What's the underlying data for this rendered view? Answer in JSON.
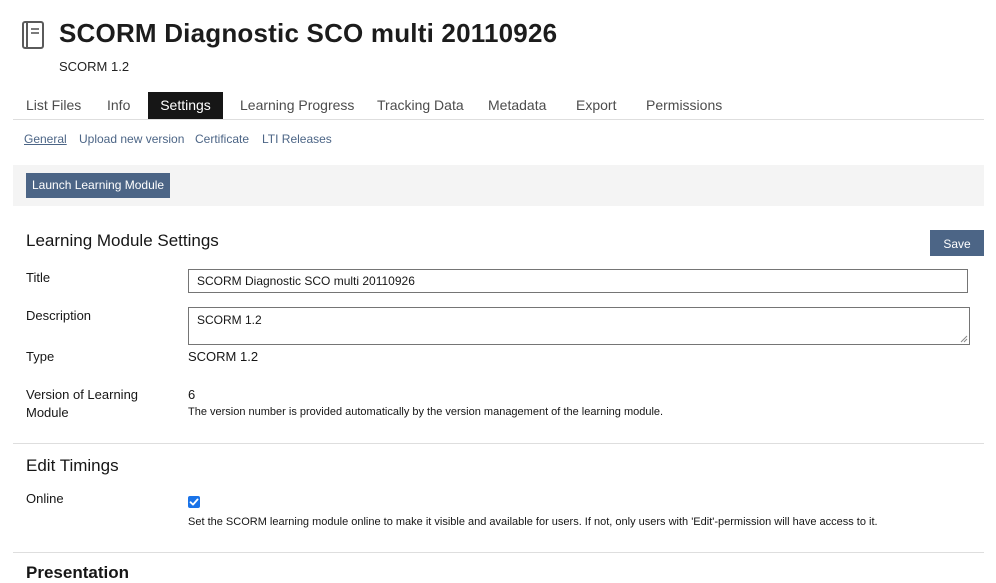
{
  "header": {
    "icon": "book-icon",
    "title": "SCORM Diagnostic SCO multi 20110926",
    "subtitle": "SCORM 1.2"
  },
  "tabs": [
    {
      "label": "List Files"
    },
    {
      "label": "Info"
    },
    {
      "label": "Settings",
      "active": true
    },
    {
      "label": "Learning Progress"
    },
    {
      "label": "Tracking Data"
    },
    {
      "label": "Metadata"
    },
    {
      "label": "Export"
    },
    {
      "label": "Permissions"
    }
  ],
  "subtabs": [
    {
      "label": "General",
      "active": true
    },
    {
      "label": "Upload new version"
    },
    {
      "label": "Certificate"
    },
    {
      "label": "LTI Releases"
    }
  ],
  "toolbar": {
    "launch_label": "Launch Learning Module"
  },
  "settings": {
    "heading": "Learning Module Settings",
    "save_label": "Save",
    "title_label": "Title",
    "title_value": "SCORM Diagnostic SCO multi 20110926",
    "description_label": "Description",
    "description_value": "SCORM 1.2",
    "type_label": "Type",
    "type_value": "SCORM 1.2",
    "version_label": "Version of Learning Module",
    "version_value": "6",
    "version_help": "The version number is provided automatically by the version management of the learning module."
  },
  "timings": {
    "heading": "Edit Timings",
    "online_label": "Online",
    "online_checked": true,
    "online_help": "Set the SCORM learning module online to make it visible and available for users. If not, only users with 'Edit'-permission will have access to it."
  },
  "presentation": {
    "heading": "Presentation"
  },
  "colors": {
    "accent": "#4c6586",
    "active_tab": "#161616",
    "checkbox": "#1a73e8"
  }
}
